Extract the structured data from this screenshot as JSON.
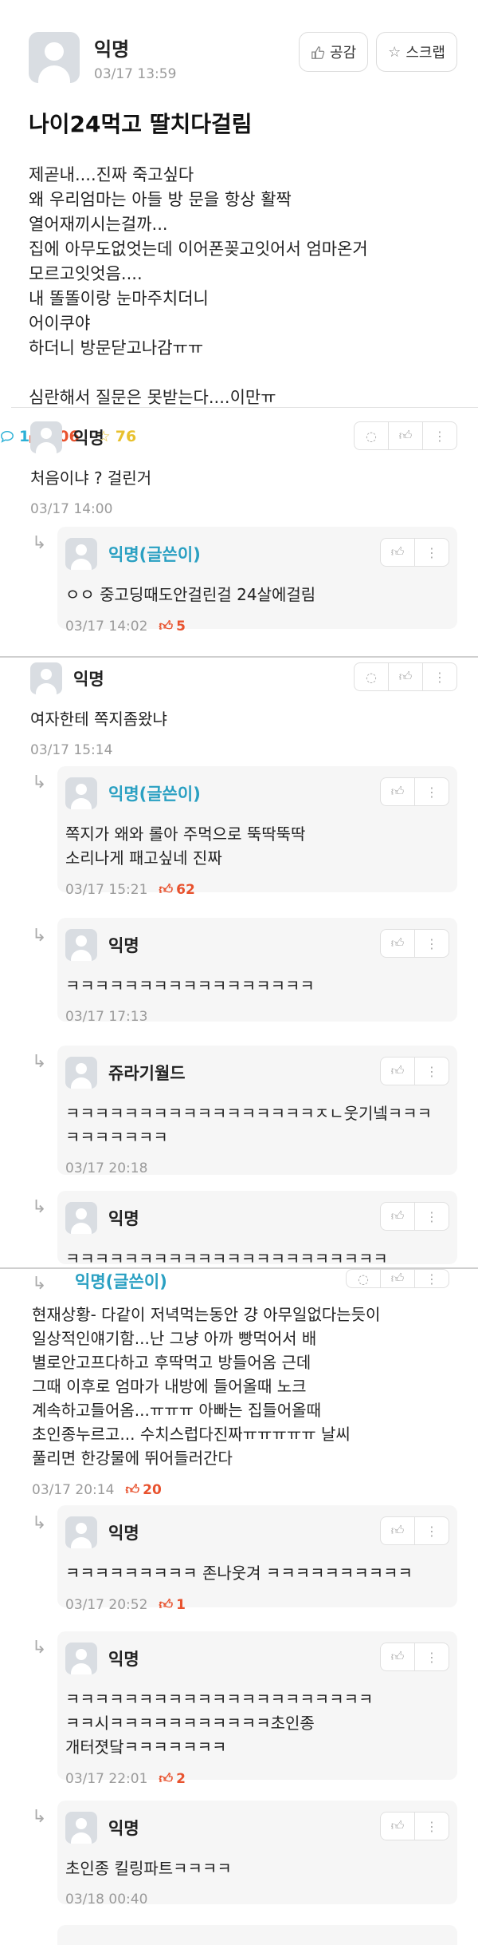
{
  "post": {
    "author": "익명",
    "date": "03/17 13:59",
    "empathize_label": "공감",
    "scrap_label": "스크랩",
    "title": "나이24먹고 딸치다걸림",
    "body": "제곧내....진짜 죽고싶다\n왜 우리엄마는 아들 방 문을 항상 활짝\n열어재끼시는걸까...\n집에 아무도없엇는데 이어폰꽂고잇어서 엄마온거\n모르고잇엇음....\n내 똘똘이랑 눈마주치더니\n어이쿠야\n하더니 방문닫고나감ㅠㅠ\n\n심란해서 질문은 못받는다....이만ㅠ",
    "likes": "206",
    "comments": "112",
    "scraps": "76"
  },
  "comments": [
    {
      "name": "익명",
      "text": "처음이냐 ? 걸린거",
      "date": "03/17 14:00",
      "likes": ""
    },
    {
      "name": "익명(글쓴이)",
      "text": "ㅇㅇ 중고딩때도안걸린걸 24살에걸림",
      "date": "03/17 14:02",
      "likes": "5"
    },
    {
      "name": "익명",
      "text": "여자한테 쪽지좀왔냐",
      "date": "03/17 15:14",
      "likes": ""
    },
    {
      "name": "익명(글쓴이)",
      "text": "쪽지가 왜와 롤아 주먹으로 뚝딱뚝딱\n소리나게 패고싶네 진짜",
      "date": "03/17 15:21",
      "likes": "62"
    },
    {
      "name": "익명",
      "text": "ㅋㅋㅋㅋㅋㅋㅋㅋㅋㅋㅋㅋㅋㅋㅋㅋㅋ",
      "date": "03/17 17:13",
      "likes": ""
    },
    {
      "name": "쥬라기월드",
      "text": "ㅋㅋㅋㅋㅋㅋㅋㅋㅋㅋㅋㅋㅋㅋㅋㅋㅋㅈㄴ웃기넼ㅋㅋㅋ\nㅋㅋㅋㅋㅋㅋㅋ",
      "date": "03/17 20:18",
      "likes": ""
    },
    {
      "name": "익명",
      "text": "ㅋㅋㅋㅋㅋㅋㅋㅋㅋㅋㅋㅋㅋㅋㅋㅋㅋㅋㅋㅋㅋㅋ",
      "date": "",
      "likes": ""
    },
    {
      "name": "익명(글쓴이)",
      "text": "현재상황- 다같이 저녁먹는동안 걍 아무일없다는듯이\n일상적인얘기함...난 그냥 아까 빵먹어서 배\n별로안고프다하고 후딱먹고 방들어옴 근데\n그때 이후로 엄마가 내방에 들어올때 노크\n계속하고들어옴...ㅠㅠㅠ 아빠는 집들어올때\n초인종누르고... 수치스럽다진짜ㅠㅠㅠㅠㅠ 날씨\n풀리면 한강물에 뛰어들러간다",
      "date": "03/17 20:14",
      "likes": "20"
    },
    {
      "name": "익명",
      "text": "ㅋㅋㅋㅋㅋㅋㅋㅋㅋ 존나웃겨 ㅋㅋㅋㅋㅋㅋㅋㅋㅋㅋ",
      "date": "03/17 20:52",
      "likes": "1"
    },
    {
      "name": "익명",
      "text": "ㅋㅋㅋㅋㅋㅋㅋㅋㅋㅋㅋㅋㅋㅋㅋㅋㅋㅋㅋㅋㅋ\nㅋㅋ시ㅋㅋㅋㅋㅋㅋㅋㅋㅋㅋㅋ초인종\n개터졋닼ㅋㅋㅋㅋㅋㅋㅋ",
      "date": "03/17 22:01",
      "likes": "2"
    },
    {
      "name": "익명",
      "text": "초인종 킬링파트ㅋㅋㅋㅋ",
      "date": "03/18 00:40",
      "likes": ""
    }
  ]
}
